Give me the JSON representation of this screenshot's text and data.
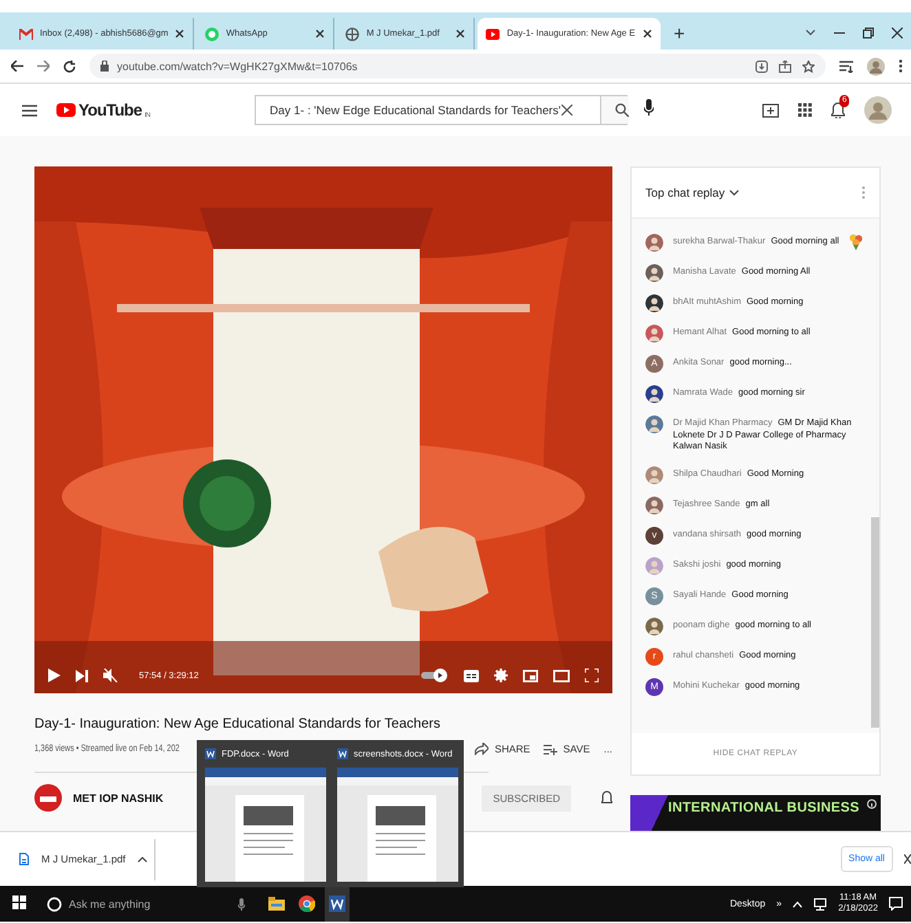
{
  "browser": {
    "tabs": [
      {
        "kind": "mail",
        "label": "Inbox (2,498) - abhish5686@gm",
        "selected": false
      },
      {
        "kind": "chat",
        "label": "WhatsApp",
        "selected": false
      },
      {
        "kind": "globe",
        "label": "M J Umekar_1.pdf",
        "selected": false
      },
      {
        "kind": "video",
        "label": "Day-1- Inauguration: New Age E",
        "selected": true
      }
    ],
    "new_tab": "+",
    "address": "youtube.com/watch?v=WgHK27gXMw&t=10706s"
  },
  "youtube": {
    "logo": "YouTube",
    "region": "IN",
    "search": {
      "value": "Day 1- : 'New Edge Educational Standards for Teachers'"
    },
    "notifications": "6"
  },
  "video": {
    "time": "57:54 / 3:29:12",
    "title": "Day-1- Inauguration: New Age Educational Standards for Teachers",
    "meta": "1,368 views • Streamed live on Feb 14, 202",
    "actions": [
      "SHARE",
      "SAVE"
    ],
    "more": "...",
    "channel": "MET IOP NASHIK",
    "subscribe": "SUBSCRIBED"
  },
  "chat": {
    "title": "Top chat replay",
    "hide": "HIDE CHAT REPLAY",
    "messages": [
      {
        "author": "surekha Barwal-Thakur",
        "text": "Good morning all",
        "color": "#a1665e",
        "sticker": true
      },
      {
        "author": "Manisha Lavate",
        "text": "Good morning All",
        "color": "#6d5f5a",
        "sticker": false
      },
      {
        "author": "bhAIt muhtAshim",
        "text": "Good morning",
        "color": "#2f3437",
        "sticker": false
      },
      {
        "author": "Hemant Alhat",
        "text": "Good morning to all",
        "color": "#c9575a",
        "sticker": false
      },
      {
        "author": "Ankita Sonar",
        "text": "good morning...",
        "kind": "letter",
        "initial": "A",
        "color": "#8d6e63",
        "sticker": false
      },
      {
        "author": "Namrata Wade",
        "text": "good morning sir",
        "color": "#2a3f8f",
        "sticker": false
      },
      {
        "author": "Dr Majid Khan Pharmacy",
        "text": "GM Dr Majid Khan Loknete Dr J D Pawar College of Pharmacy Kalwan Nasik",
        "color": "#5a7a9a",
        "sticker": false
      },
      {
        "author": "Shilpa Chaudhari",
        "text": "Good Morning",
        "color": "#b08a78",
        "sticker": false
      },
      {
        "author": "Tejashree Sande",
        "text": "gm all",
        "color": "#8a6a60",
        "sticker": false
      },
      {
        "author": "vandana shirsath",
        "text": "good morning",
        "kind": "letter",
        "initial": "v",
        "color": "#5d4037",
        "sticker": false
      },
      {
        "author": "Sakshi joshi",
        "text": "good morning",
        "color": "#b9a3c9",
        "sticker": false
      },
      {
        "author": "Sayali Hande",
        "text": "Good morning",
        "kind": "letter",
        "initial": "S",
        "color": "#78909c",
        "sticker": false
      },
      {
        "author": "poonam dighe",
        "text": "good morning to all",
        "color": "#7a6a4a",
        "sticker": false
      },
      {
        "author": "rahul chansheti",
        "text": "Good morning",
        "kind": "letter",
        "initial": "r",
        "color": "#e64a19",
        "sticker": false
      },
      {
        "author": "Mohini Kuchekar",
        "text": "good morning",
        "kind": "letter",
        "initial": "M",
        "color": "#5e35b1",
        "sticker": false
      }
    ]
  },
  "ad": {
    "text": "INTERNATIONAL BUSINESS"
  },
  "download_bar": {
    "file": "M J Umekar_1.pdf",
    "show_all": "Show all"
  },
  "previews": [
    {
      "title": "FDP.docx - Word"
    },
    {
      "title": "screenshots.docx - Word"
    }
  ],
  "taskbar": {
    "search": {
      "placeholder": "Ask me anything"
    },
    "desktop": "Desktop",
    "overflow": "»",
    "time": "11:18 AM",
    "date": "2/18/2022"
  }
}
